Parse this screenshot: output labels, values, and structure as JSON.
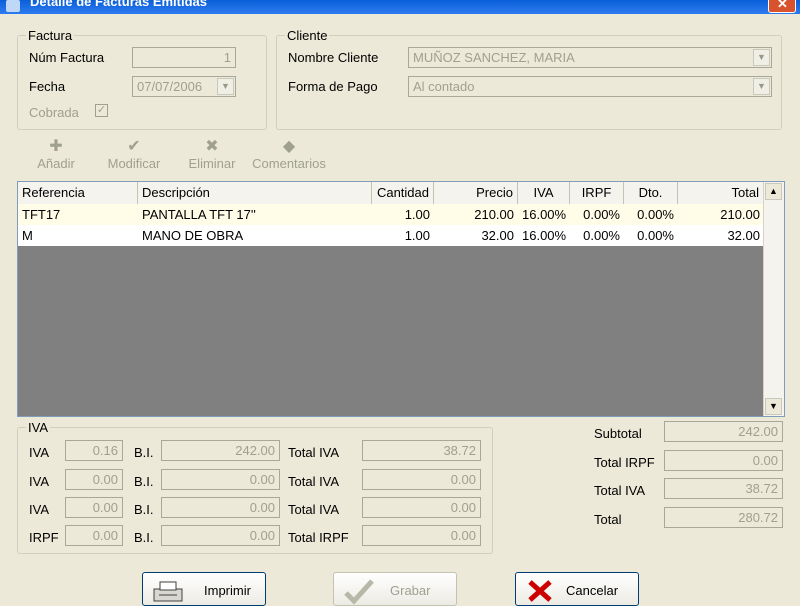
{
  "window": {
    "title": "Detalle de Facturas Emitidas",
    "close_glyph": "✕"
  },
  "factura": {
    "legend": "Factura",
    "num_label": "Núm Factura",
    "num_value": "1",
    "fecha_label": "Fecha",
    "fecha_value": "07/07/2006",
    "cobrada_label": "Cobrada",
    "cobrada_checked": true
  },
  "cliente": {
    "legend": "Cliente",
    "nombre_label": "Nombre Cliente",
    "nombre_value": "MUÑOZ SANCHEZ, MARIA",
    "pago_label": "Forma de Pago",
    "pago_value": "Al contado"
  },
  "toolbar": {
    "add_label": "Añadir",
    "modify_label": "Modificar",
    "delete_label": "Eliminar",
    "comments_label": "Comentarios",
    "add_icon": "plus-icon",
    "modify_icon": "checkmark-icon",
    "delete_icon": "x-icon",
    "comments_icon": "comment-icon"
  },
  "grid": {
    "headers": [
      "Referencia",
      "Descripción",
      "Cantidad",
      "Precio",
      "IVA",
      "IRPF",
      "Dto.",
      "Total"
    ],
    "rows": [
      [
        "TFT17",
        "PANTALLA TFT 17''",
        "1.00",
        "210.00",
        "16.00%",
        "0.00%",
        "0.00%",
        "210.00"
      ],
      [
        "M",
        "MANO DE OBRA",
        "1.00",
        "32.00",
        "16.00%",
        "0.00%",
        "0.00%",
        "32.00"
      ]
    ]
  },
  "iva": {
    "legend": "IVA",
    "rows": [
      {
        "label": "IVA",
        "pct": "0.16",
        "bi_label": "B.I.",
        "bi": "242.00",
        "total_label": "Total IVA",
        "total": "38.72"
      },
      {
        "label": "IVA",
        "pct": "0.00",
        "bi_label": "B.I.",
        "bi": "0.00",
        "total_label": "Total IVA",
        "total": "0.00"
      },
      {
        "label": "IVA",
        "pct": "0.00",
        "bi_label": "B.I.",
        "bi": "0.00",
        "total_label": "Total IVA",
        "total": "0.00"
      },
      {
        "label": "IRPF",
        "pct": "0.00",
        "bi_label": "B.I.",
        "bi": "0.00",
        "total_label": "Total IRPF",
        "total": "0.00"
      }
    ]
  },
  "totals": {
    "subtotal_label": "Subtotal",
    "subtotal": "242.00",
    "irpf_label": "Total IRPF",
    "irpf": "0.00",
    "iva_label": "Total IVA",
    "iva": "38.72",
    "total_label": "Total",
    "total": "280.72"
  },
  "buttons": {
    "print_label": "Imprimir",
    "save_label": "Grabar",
    "cancel_label": "Cancelar"
  },
  "colors": {
    "row_selected": "#fffde8",
    "grid_empty": "#808080",
    "disabled_text": "#a0a090",
    "cancel_x": "#cc0000"
  }
}
